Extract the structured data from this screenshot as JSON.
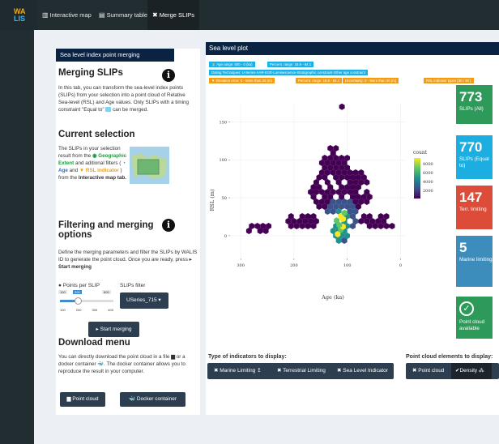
{
  "logo": {
    "line1": "WA",
    "line2": "LIS"
  },
  "nav": {
    "tabs": [
      {
        "label": "Interactive map",
        "icon": "map-icon"
      },
      {
        "label": "Summary table",
        "icon": "table-icon"
      },
      {
        "label": "Merge SLIPs",
        "icon": "merge-icon"
      }
    ]
  },
  "left": {
    "header": "Sea level index point merging",
    "merging_title": "Merging SLIPs",
    "merging_text": "In this tab, you can transform the sea-level index points (SLIPs) from your selection into a point cloud of Relative Sea-level (RSL) and Age values. Only SLIPs with a timing constraint \"Equal to\"",
    "merging_text_end": "can be merged.",
    "selection_title": "Current selection",
    "selection_text_1": "The SLIPs in your selection result from the",
    "selection_geo": "Geographic Extent",
    "selection_text_2": "and aditional filters (",
    "selection_age": "Age",
    "selection_and": "and",
    "selection_rsl": "RSL indicator",
    "selection_text_3": ") from the",
    "selection_tab": "Interactive map tab.",
    "filter_title_1": "Filtering and merging",
    "filter_title_2": "options",
    "filter_text": "Define the merging parameters and filter the SLIPs by WALIS ID to generate the point cloud. Once you are ready, press",
    "filter_text_bold": "Start merging",
    "points_label": "Points per SLIP",
    "slider": {
      "min": "100",
      "value": "200",
      "max": "600",
      "ticks": [
        "100",
        "200",
        "300",
        "400"
      ]
    },
    "slips_filter_label": "SLIPs filter",
    "slips_filter_value": "USeries_715",
    "start_button": "Start merging",
    "download_title": "Download menu",
    "download_text_1": "You can directly download the point cloud in a file",
    "download_text_2": "or a docker container",
    "download_text_3": ". The docker container allows you to reproduce the result in your computer.",
    "point_cloud_button": "Point cloud",
    "docker_button": "Docker container"
  },
  "right": {
    "header": "Sea level plot",
    "badges": [
      {
        "text": "Age range: 500 - 0 (ka)",
        "color": "#1ab0e8"
      },
      {
        "text": "Percent. range: 15.9 - 84.1",
        "color": "#1ab0e8"
      },
      {
        "text": "Dating Techniques: U-Series-AAR-ESR-Luminescence-Stratigraphic constraint-Other age constraint",
        "color": "#1ab0e8"
      },
      {
        "text": "Elevation error: 0 - More than 20 (m)",
        "color": "#f39c12"
      },
      {
        "text": "Percent. range: 15.9 - 84.1",
        "color": "#f39c12"
      },
      {
        "text": "Uncertainty: 0 - More than 20 (m)",
        "color": "#f39c12"
      },
      {
        "text": "RSL indicator types (30 / 30 )",
        "color": "#f39c12"
      }
    ],
    "cards": [
      {
        "value": "773",
        "label": "SLIPs (All)",
        "color": "#2e9a5a"
      },
      {
        "value": "770",
        "label": "SLIPs (Equal to)",
        "color": "#1caee0"
      },
      {
        "value": "147",
        "label": "Terr. limiting",
        "color": "#dd4b39"
      },
      {
        "value": "5",
        "label": "Marine limiting",
        "color": "#3c8dbc"
      },
      {
        "value": "",
        "label": "Point cloud available",
        "color": "#2e9a5a"
      }
    ],
    "type_label": "Type of indicators to display:",
    "type_buttons": [
      "Marine Limiting",
      "Terrestrial Limiting",
      "Sea Level Indicator"
    ],
    "elements_label": "Point cloud elements to display:",
    "element_buttons": [
      "Point cloud",
      "Density"
    ]
  },
  "chart_data": {
    "type": "heatmap",
    "xlabel": "Age (ka)",
    "ylabel": "RSL (m)",
    "x_ticks": [
      "300",
      "200",
      "100",
      "0"
    ],
    "y_ticks": [
      "150",
      "100",
      "50",
      "0"
    ],
    "xlim": [
      320,
      -10
    ],
    "ylim": [
      -30,
      175
    ],
    "legend_title": "count",
    "legend_ticks": [
      "8000",
      "6000",
      "4000",
      "2000"
    ],
    "colorscale": [
      "#440154",
      "#3b528b",
      "#21918c",
      "#5ec962",
      "#fde725"
    ],
    "cells": [
      {
        "x": 118,
        "y": 2
      },
      {
        "x": 112,
        "y": 8
      },
      {
        "x": 108,
        "y": 12
      },
      {
        "x": 115,
        "y": 14
      },
      {
        "x": 108,
        "y": 22
      },
      {
        "x": 120,
        "y": 20
      },
      {
        "x": 112,
        "y": 26
      },
      {
        "x": 105,
        "y": 30
      }
    ]
  }
}
